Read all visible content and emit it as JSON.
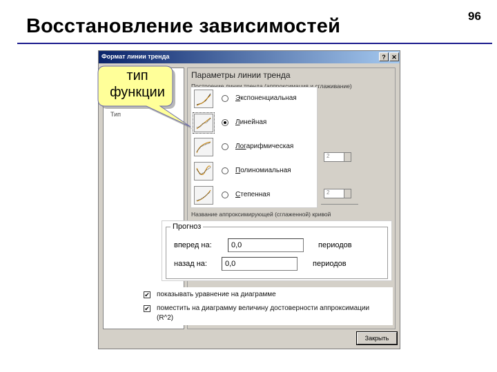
{
  "slide": {
    "title": "Восстановление зависимостей",
    "number": "96"
  },
  "dialog": {
    "title": "Формат линии тренда",
    "help_btn": "?",
    "close_btn": "✕",
    "left_items": [
      "Тип"
    ],
    "section_title": "Параметры линии тренда",
    "section_sub": "Построение линии тренда (аппроксимация и сглаживание)",
    "section_sub2": "Название аппроксимирующей (сглаженной) кривой",
    "spin1": "2",
    "spin2": "2",
    "close_label": "Закрыть"
  },
  "trend_types": [
    {
      "label": "Экспоненциальная",
      "underline": "Э",
      "rest": "кспоненциальная",
      "selected": false,
      "icon": "exponential-chart-icon"
    },
    {
      "label": "Линейная",
      "underline": "Л",
      "rest": "инейная",
      "selected": true,
      "icon": "linear-chart-icon"
    },
    {
      "label": "Логарифмическая",
      "underline": "Лог",
      "rest": "арифмическая",
      "selected": false,
      "icon": "logarithmic-chart-icon"
    },
    {
      "label": "Полиномиальная",
      "underline": "П",
      "rest": "олиномиальная",
      "selected": false,
      "icon": "polynomial-chart-icon"
    },
    {
      "label": "Степенная",
      "underline": "С",
      "rest": "тепенная",
      "selected": false,
      "icon": "power-chart-icon"
    }
  ],
  "forecast": {
    "title": "Прогноз",
    "forward_label": "вперед на:",
    "forward_value": "0,0",
    "forward_unit": "периодов",
    "back_label": "назад на:",
    "back_value": "0,0",
    "back_unit": "периодов"
  },
  "checks": {
    "show_equation": "показывать уравнение на диаграмме",
    "show_r2": "поместить на диаграмму величину достоверности аппроксимации",
    "show_r2_line2": "(R^2)",
    "mark": "✔"
  },
  "callout": {
    "line1": "тип",
    "line2": "функции"
  },
  "colors": {
    "title_rule": "#1a1a8c",
    "callout_fill": "#ffff99",
    "titlebar": "#0a246a"
  }
}
